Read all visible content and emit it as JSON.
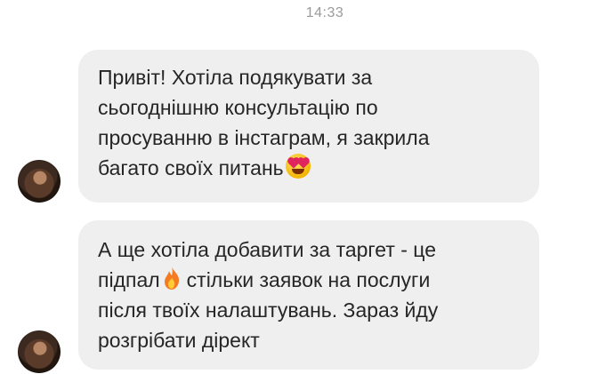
{
  "chat": {
    "timestamp": "14:33",
    "messages": [
      {
        "lines": [
          "Привіт! Хотіла подякувати за",
          "сьогоднішню консультацію по",
          "просуванню в інстаграм, я закрила",
          "багато своїх питань"
        ],
        "trailing_emoji": "heart-eyes-emoji"
      },
      {
        "lines": [
          "А ще хотіла добавити за таргет - це",
          "підпал",
          "стільки заявок на послуги",
          "після твоїх налаштувань. Зараз йду",
          "розгрібати дірект"
        ],
        "inline_emoji": "fire-emoji"
      }
    ],
    "bubble_color": "#efefef",
    "text_color": "#262626"
  }
}
